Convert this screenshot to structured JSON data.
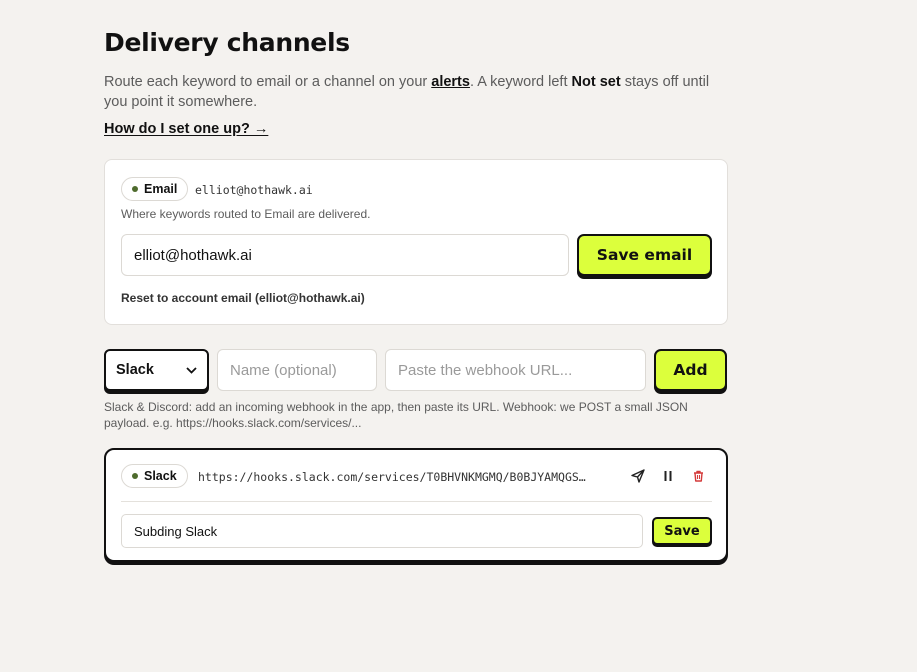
{
  "page": {
    "title": "Delivery channels",
    "intro_part1": "Route each keyword to email or a channel on your ",
    "intro_link": "alerts",
    "intro_part2": ". A keyword left ",
    "intro_bold": "Not set",
    "intro_part3": " stays off until you point it somewhere.",
    "help_link": "How do I set one up? →"
  },
  "email_card": {
    "pill_label": "Email",
    "address_mono": "elliot@hothawk.ai",
    "hint": "Where keywords routed to Email are delivered.",
    "input_value": "elliot@hothawk.ai",
    "save_label": "Save email",
    "reset_label": "Reset to account email (elliot@hothawk.ai)"
  },
  "add_row": {
    "type_selected": "Slack",
    "name_placeholder": "Name (optional)",
    "url_placeholder": "Paste the webhook URL...",
    "add_label": "Add",
    "hint": "Slack & Discord: add an incoming webhook in the app, then paste its URL. Webhook: we POST a small JSON payload. e.g. https://hooks.slack.com/services/..."
  },
  "channels": [
    {
      "type": "Slack",
      "url": "https://hooks.slack.com/services/T0BHVNKMGMQ/B0BJYAMQGS…",
      "name_value": "Subding Slack",
      "save_label": "Save"
    }
  ],
  "icons": {
    "send": "send-icon",
    "pause": "pause-icon",
    "trash": "trash-icon",
    "chevron": "chevron-down-icon"
  },
  "colors": {
    "accent": "#dcff3c",
    "status_dot": "#4e6b2d",
    "danger": "#d43a3a",
    "background": "#f4f2ef"
  }
}
